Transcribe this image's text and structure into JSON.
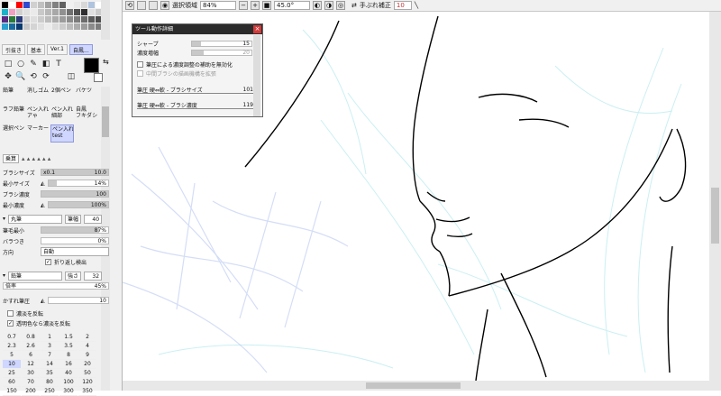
{
  "swatch_colors": [
    "#000000",
    "#ffffff",
    "#ff0000",
    "#2f4ad0",
    "#d0d0d0",
    "#c0c0c0",
    "#a0a0a0",
    "#808080",
    "#606060",
    "#f0f0f0",
    "#e8e8e8",
    "#d8d8d8",
    "#b0c4de",
    "#ffffff",
    "#19b4c8",
    "#f0a0c0",
    "#d0d0d0",
    "#e0e0e0",
    "#eaeaea",
    "#c8c8c8",
    "#b8b8b8",
    "#a8a8a8",
    "#909090",
    "#707070",
    "#505050",
    "#303030",
    "#e0e0e0",
    "#cccccc",
    "#5a2a82",
    "#2a7a3a",
    "#2a3a7a",
    "#d0d0d0",
    "#dedede",
    "#cccccc",
    "#bcbcbc",
    "#acacac",
    "#9c9c9c",
    "#8c8c8c",
    "#7c7c7c",
    "#6c6c6c",
    "#5c5c5c",
    "#4c4c4c",
    "#2aa0d0",
    "#1a6aa0",
    "#0a3a70",
    "#c8c8c8",
    "#d4d4d4",
    "#e0e0e0",
    "#ececec",
    "#dcdcdc",
    "#cccccc",
    "#bcbcbc",
    "#acacac",
    "#9c9c9c",
    "#8c8c8c",
    "#7c7c7c"
  ],
  "tabs": [
    "引抜き",
    "基本",
    "Ver.1",
    "自鳳..."
  ],
  "tool_icons": [
    "□",
    "○",
    "✎",
    "◧",
    "T",
    "",
    "✥",
    "🔍",
    "⟲",
    "⟳",
    "",
    "◫"
  ],
  "tools": [
    "鉛筆",
    "消しゴム",
    "2個ペン",
    "バケツ",
    "ラフ鉛筆",
    "ペン入れ\nアゃ",
    "ペン入れ\n細部",
    "自鳳\nフキダシ",
    "選択ペン",
    "マーカー",
    "ペン入れ\ntest",
    ""
  ],
  "brush_type": "乗算",
  "brush_size": {
    "label": "ブラシサイズ",
    "mult": "x0.1",
    "value": "10.0"
  },
  "min_size": {
    "label": "最小サイズ",
    "value": "14%",
    "fill": 0.14
  },
  "brush_density": {
    "label": "ブラシ濃度",
    "value": "100",
    "fill": 1.0
  },
  "min_density": {
    "label": "最小濃度",
    "value": "100%",
    "fill": 1.0
  },
  "shape1": {
    "name": "丸筆",
    "label2": "筆幅",
    "value": "40"
  },
  "brush_min": {
    "label": "筆毛最小",
    "value": "87%",
    "fill": 0.87
  },
  "variation": {
    "label": "バラつき",
    "value": "0%",
    "fill": 0
  },
  "direction": {
    "label": "方向",
    "value": "自動"
  },
  "repeat": "折り返し検出",
  "shape2": {
    "name": "鉛筆",
    "label2": "強さ",
    "value": "32"
  },
  "magnification": {
    "label": "倍率",
    "value": "45%",
    "fill": 0.45
  },
  "blur_pressure": {
    "label": "かすれ筆圧",
    "value": "10"
  },
  "invert_density": "濃淡を反転",
  "transparent_density": "透明色なら濃淡を反転",
  "sizes": [
    "0.7",
    "0.8",
    "1",
    "1.5",
    "2",
    "2.3",
    "2.6",
    "3",
    "3.5",
    "4",
    "5",
    "6",
    "7",
    "8",
    "9",
    "10",
    "12",
    "14",
    "16",
    "20",
    "25",
    "30",
    "35",
    "40",
    "50",
    "60",
    "70",
    "80",
    "100",
    "120",
    "150",
    "200",
    "250",
    "300",
    "350"
  ],
  "topbar": {
    "sel_label": "選択領域",
    "zoom": "84%",
    "rotate": "45.0°",
    "stab_label": "手ぶれ補正",
    "stab_value": "10"
  },
  "panel": {
    "title": "ツール動作詳細",
    "sharp": {
      "label": "シャープ",
      "value": "15",
      "fill": 0.15
    },
    "density_gain": {
      "label": "濃度増幅",
      "value": "20",
      "fill": 0.2
    },
    "disable_pressure": "筆圧による濃度調整の補助を無効化",
    "mid_brush": "中間ブラシの描画機構を拡張",
    "size_curve": {
      "label": "筆圧 硬⇔軟 - ブラシサイズ",
      "value": "101"
    },
    "density_curve": {
      "label": "筆圧 硬⇔軟 - ブラシ濃度",
      "value": "119"
    }
  },
  "colors": {
    "accent": "#cfd6ff",
    "close": "#d23b3b",
    "panel_title": "#2b2b2b"
  }
}
